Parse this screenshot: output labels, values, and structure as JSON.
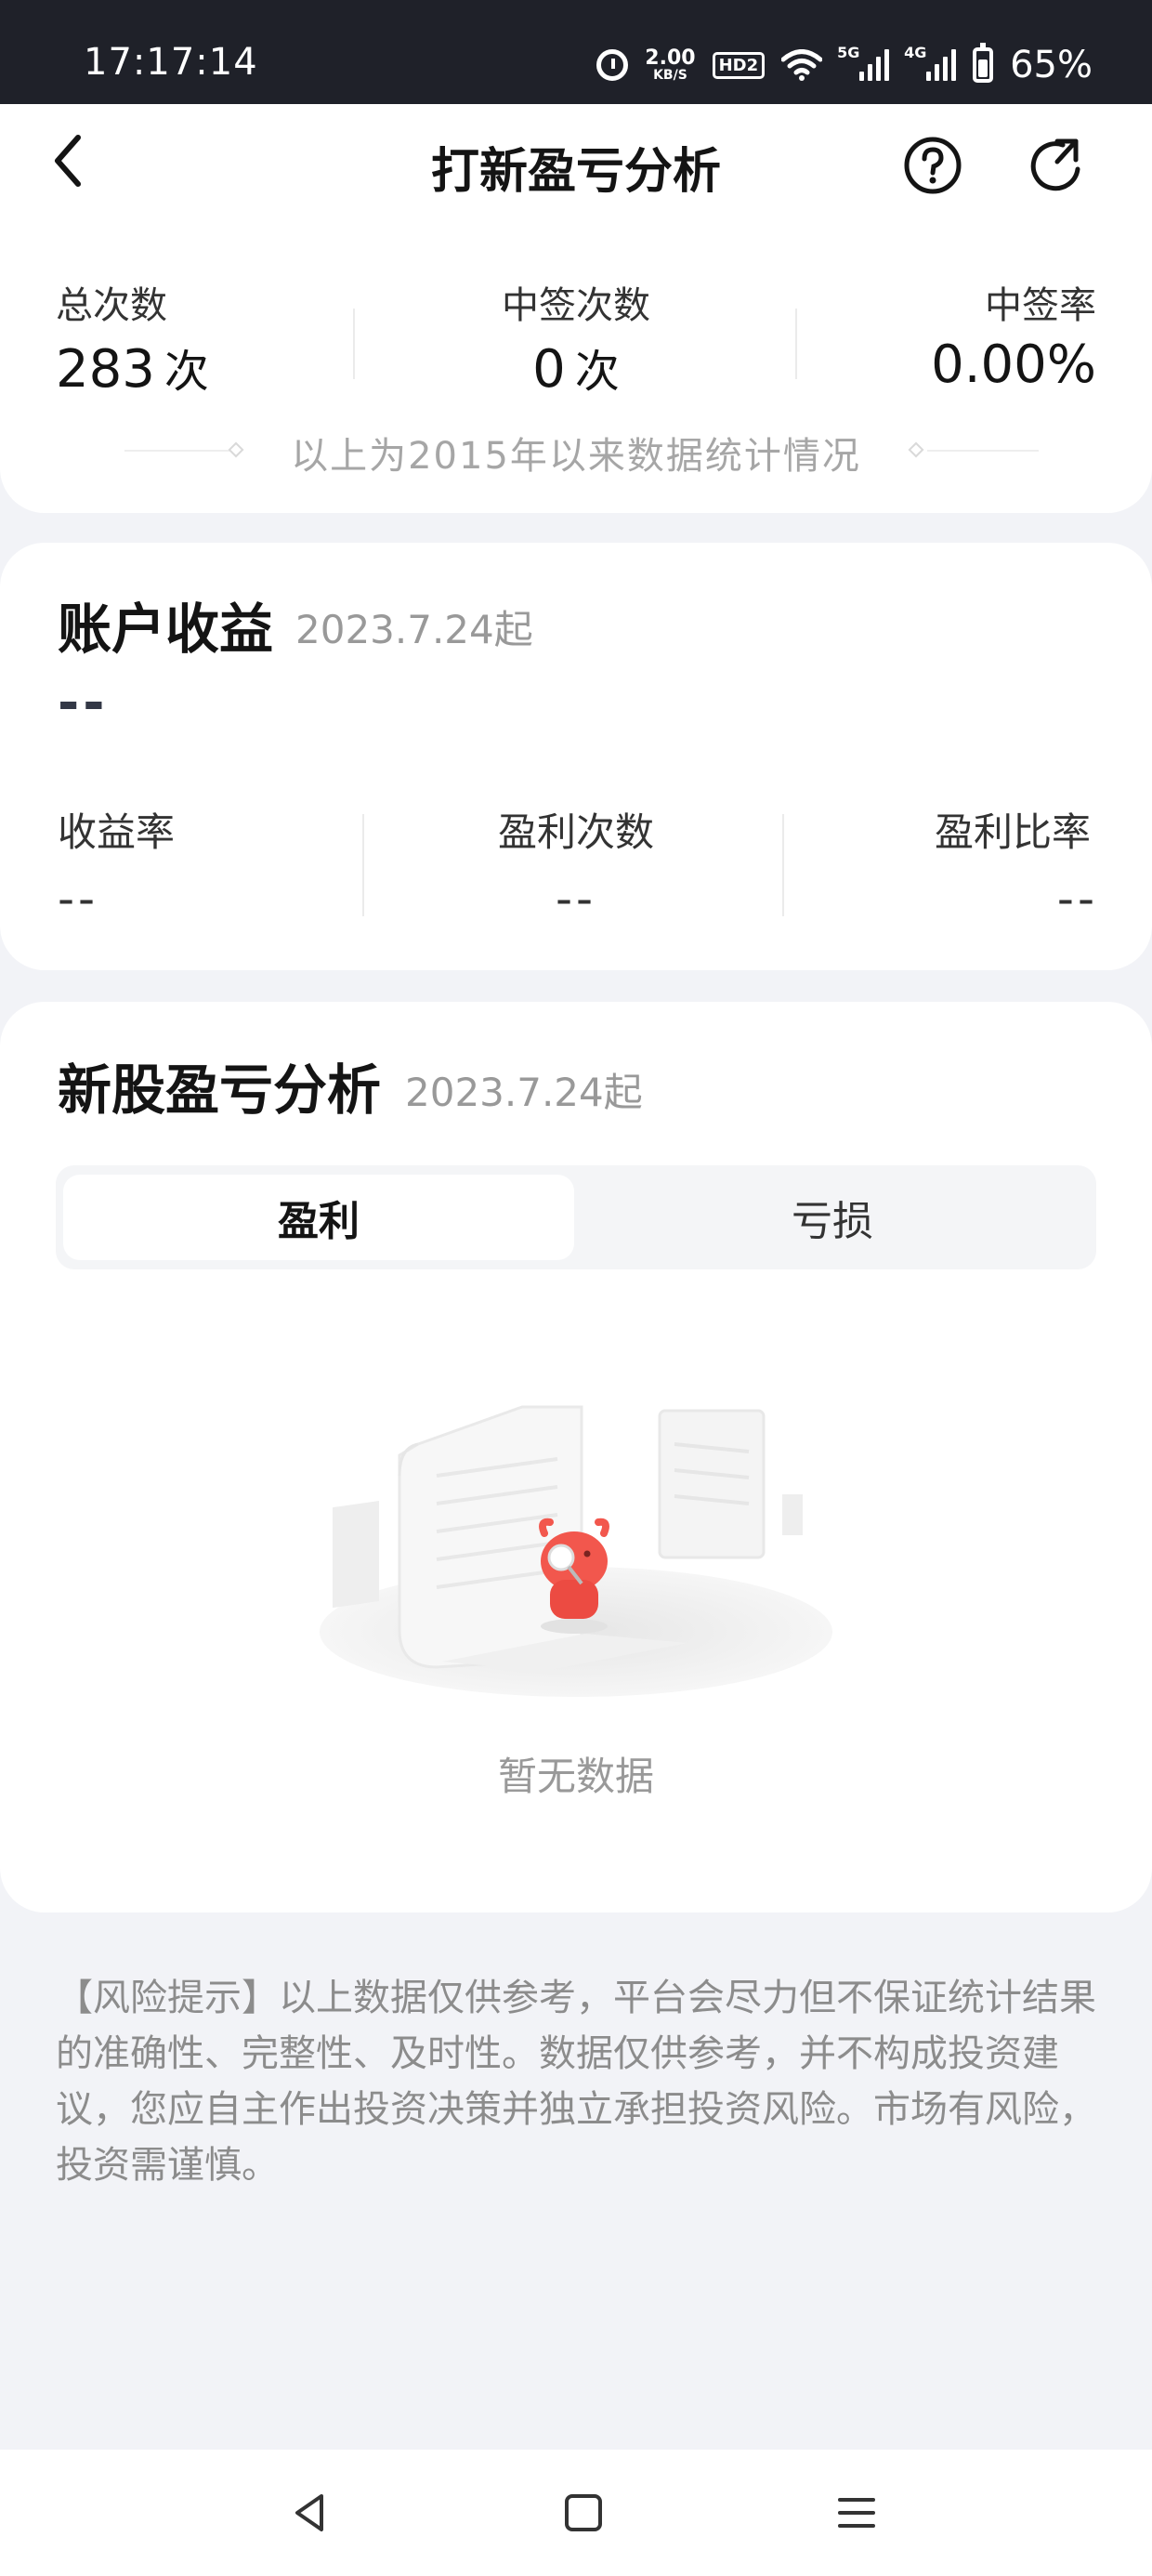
{
  "status_bar": {
    "time": "17:17:14",
    "net_speed_value": "2.00",
    "net_speed_unit": "KB/S",
    "hd_badge": "HD2",
    "sim1_label": "5G",
    "sim2_label": "4G",
    "battery_percent": "65%",
    "battery_level": 0.65
  },
  "nav": {
    "title": "打新盈亏分析",
    "icons": [
      "back-icon",
      "help-icon",
      "share-icon"
    ]
  },
  "summary": {
    "total_label": "总次数",
    "total_value": "283",
    "total_unit": "次",
    "win_label": "中签次数",
    "win_value": "0",
    "win_unit": "次",
    "rate_label": "中签率",
    "rate_value": "0.00%",
    "footnote": "以上为2015年以来数据统计情况"
  },
  "account": {
    "title": "账户收益",
    "since": "2023.7.24起",
    "value": "--",
    "metrics": [
      {
        "label": "收益率",
        "value": "--"
      },
      {
        "label": "盈利次数",
        "value": "--"
      },
      {
        "label": "盈利比率",
        "value": "--"
      }
    ]
  },
  "ipo": {
    "title": "新股盈亏分析",
    "since": "2023.7.24起",
    "tabs": [
      {
        "label": "盈利",
        "active": true
      },
      {
        "label": "亏损",
        "active": false
      }
    ],
    "empty_text": "暂无数据",
    "illustration": "empty-state-bull-icon"
  },
  "disclaimer": "【风险提示】以上数据仅供参考，平台会尽力但不保证统计结果的准确性、完整性、及时性。数据仅供参考，并不构成投资建议，您应自主作出投资决策并独立承担投资风险。市场有风险，投资需谨慎。",
  "system_nav": {
    "icons": [
      "back-triangle-icon",
      "home-square-icon",
      "menu-lines-icon"
    ]
  },
  "colors": {
    "page_bg": "#f2f3f7",
    "status_bar_bg": "#1f2129",
    "card_bg": "#ffffff",
    "muted_text": "#999999",
    "mascot_red": "#f2574d"
  }
}
